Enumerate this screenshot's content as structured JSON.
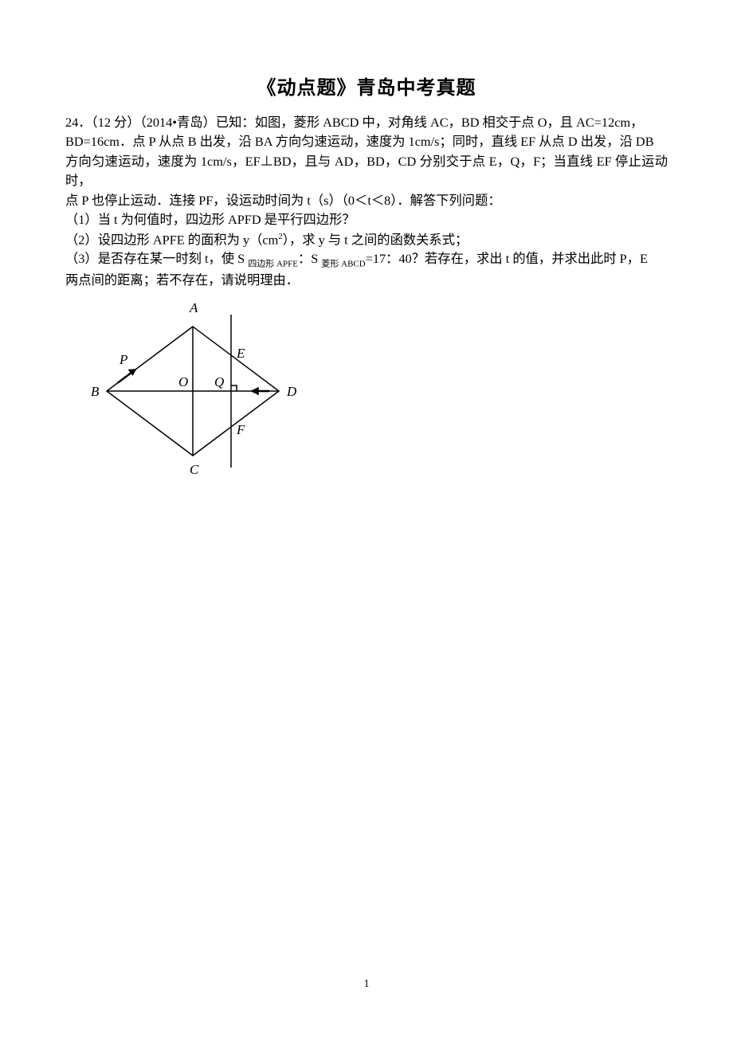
{
  "title": "《动点题》青岛中考真题",
  "problem": {
    "number_points": "24．（12 分）（2014•青岛）已知：如图，菱形 ABCD 中，对角线 AC，BD 相交于点 O，且 AC=12cm，",
    "line2": "BD=16cm．点 P 从点 B 出发，沿 BA 方向匀速运动，速度为 1cm/s；同时，直线 EF 从点 D 出发，沿 DB",
    "line3": "方向匀速运动，速度为 1cm/s，EF⊥BD，且与 AD，BD，CD 分别交于点 E，Q，F；当直线 EF 停止运动时，",
    "line4": "点 P 也停止运动．连接 PF，设运动时间为 t（s）（0＜t＜8）．解答下列问题：",
    "q1": "（1）当 t 为何值时，四边形 APFD 是平行四边形？",
    "q2a": "（2）设四边形 APFE 的面积为 y（cm",
    "q2_sup": "2",
    "q2b": "），求 y 与 t 之间的函数关系式；",
    "q3a": "（3）是否存在某一时刻 t，使 S ",
    "q3_sub1": "四边形 APFE",
    "q3b": "：S ",
    "q3_sub2": "菱形 ABCD",
    "q3c": "=17：40？若存在，求出 t 的值，并求出此时 P，E",
    "q3d": "两点间的距离；若不存在，请说明理由．"
  },
  "figure_labels": {
    "A": "A",
    "B": "B",
    "C": "C",
    "D": "D",
    "E": "E",
    "F": "F",
    "O": "O",
    "P": "P",
    "Q": "Q"
  },
  "page_number": "1"
}
